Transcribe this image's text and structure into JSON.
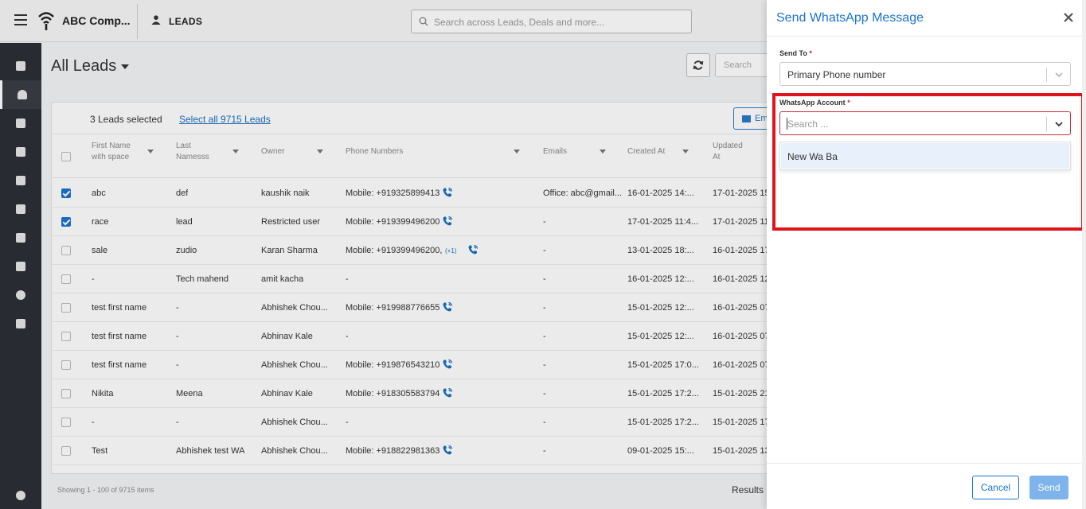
{
  "header": {
    "company": "ABC Comp...",
    "module": "LEADS",
    "search_placeholder": "Search across Leads, Deals and more..."
  },
  "page": {
    "title": "All Leads",
    "search_placeholder": "Search",
    "selected_count": "3 Leads selected",
    "select_all": "Select all 9715 Leads",
    "email_label": "Em"
  },
  "table": {
    "columns": {
      "first_name": [
        "First Name",
        "with space"
      ],
      "last_name": [
        "Last",
        "Namesss"
      ],
      "owner": "Owner",
      "phones": "Phone Numbers",
      "emails": "Emails",
      "created": "Created At",
      "updated": [
        "Updated",
        "At"
      ]
    },
    "rows": [
      {
        "checked": true,
        "first": "abc",
        "last": "def",
        "owner": "kaushik naik",
        "phone": "Mobile: +919325899413",
        "more": "",
        "phone_icon": true,
        "email": "Office: abc@gmail...",
        "created": "16-01-2025 14:...",
        "updated": "17-01-2025 15"
      },
      {
        "checked": true,
        "first": "race",
        "last": "lead",
        "owner": "Restricted user",
        "phone": "Mobile: +919399496200",
        "more": "",
        "phone_icon": true,
        "email": "-",
        "created": "17-01-2025 11:4...",
        "updated": "17-01-2025 11"
      },
      {
        "checked": false,
        "first": "sale",
        "last": "zudio",
        "owner": "Karan Sharma",
        "phone": "Mobile: +919399496200,",
        "more": "(+1)",
        "phone_icon": true,
        "email": "-",
        "created": "13-01-2025 18:...",
        "updated": "16-01-2025 17"
      },
      {
        "checked": false,
        "first": "-",
        "last": "Tech mahend",
        "owner": "amit kacha",
        "phone": "-",
        "more": "",
        "phone_icon": false,
        "email": "-",
        "created": "16-01-2025 12:...",
        "updated": "16-01-2025 12"
      },
      {
        "checked": false,
        "first": "test first name",
        "last": "-",
        "owner": "Abhishek Chou...",
        "phone": "Mobile: +919988776655",
        "more": "",
        "phone_icon": true,
        "email": "-",
        "created": "15-01-2025 12:...",
        "updated": "16-01-2025 07"
      },
      {
        "checked": false,
        "first": "test first name",
        "last": "-",
        "owner": "Abhinav Kale",
        "phone": "-",
        "more": "",
        "phone_icon": false,
        "email": "-",
        "created": "15-01-2025 12:...",
        "updated": "16-01-2025 07"
      },
      {
        "checked": false,
        "first": "test first name",
        "last": "-",
        "owner": "Abhishek Chou...",
        "phone": "Mobile: +919876543210",
        "more": "",
        "phone_icon": true,
        "email": "-",
        "created": "15-01-2025 17:0...",
        "updated": "16-01-2025 07"
      },
      {
        "checked": false,
        "first": "Nikita",
        "last": "Meena",
        "owner": "Abhinav Kale",
        "phone": "Mobile: +918305583794",
        "more": "",
        "phone_icon": true,
        "email": "-",
        "created": "15-01-2025 17:2...",
        "updated": "15-01-2025 21"
      },
      {
        "checked": false,
        "first": "-",
        "last": "-",
        "owner": "Abhishek Chou...",
        "phone": "-",
        "more": "",
        "phone_icon": false,
        "email": "-",
        "created": "15-01-2025 17:2...",
        "updated": "15-01-2025 17"
      },
      {
        "checked": false,
        "first": "Test",
        "last": "Abhishek test WA",
        "owner": "Abhishek Chou...",
        "phone": "Mobile: +918822981363",
        "more": "",
        "phone_icon": true,
        "email": "-",
        "created": "09-01-2025 15:...",
        "updated": "15-01-2025 13"
      }
    ]
  },
  "footer": {
    "showing": "Showing 1 - 100 of 9715 items",
    "results": "Results"
  },
  "panel": {
    "title": "Send WhatsApp Message",
    "send_to_label": "Send To",
    "send_to_value": "Primary Phone number",
    "account_label": "WhatsApp Account",
    "account_placeholder": "Search ...",
    "options": [
      "New Wa Ba"
    ],
    "cancel": "Cancel",
    "send": "Send",
    "required_mark": "*"
  },
  "colors": {
    "accent": "#1a73d0",
    "highlight": "#e0141e",
    "sidebar": "#2c2f36"
  }
}
